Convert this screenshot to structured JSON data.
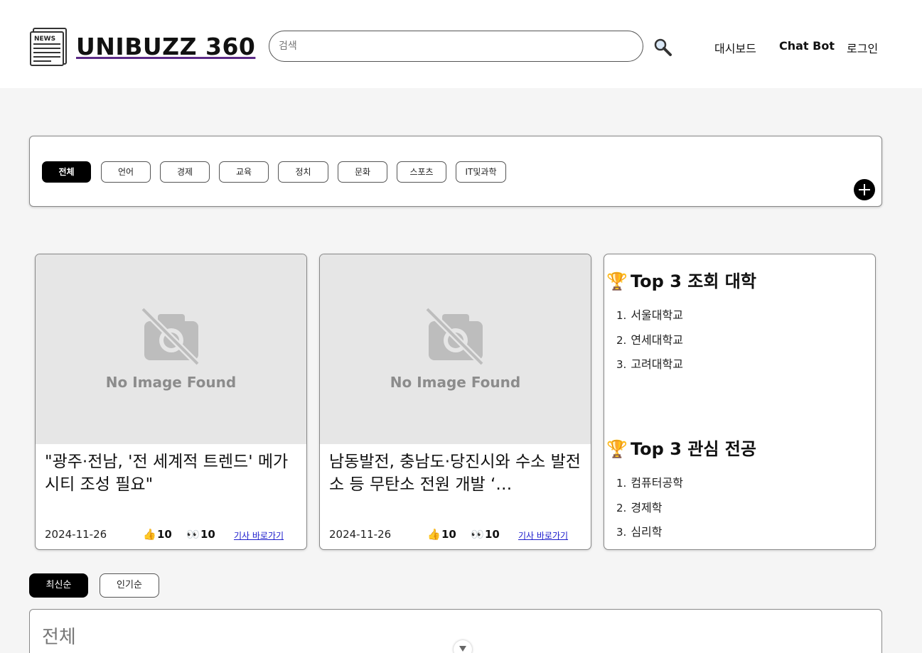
{
  "header": {
    "logo_badge": "NEWS",
    "logo_text": "UNIBUZZ 360",
    "search_placeholder": "검색",
    "search_icon": "magnifier-icon",
    "nav": {
      "dashboard": "대시보드",
      "chatbot": "Chat Bot",
      "login": "로그인"
    }
  },
  "categories": [
    {
      "label": "전체",
      "active": true
    },
    {
      "label": "언어"
    },
    {
      "label": "경제"
    },
    {
      "label": "교육"
    },
    {
      "label": "정치"
    },
    {
      "label": "문화"
    },
    {
      "label": "스포츠"
    },
    {
      "label": "IT및과학"
    }
  ],
  "add_category_icon": "plus-icon",
  "articles": [
    {
      "image_text": "No Image Found",
      "title": "\"광주·전남, '전 세계적 트렌드' 메가시티 조성 필요\"",
      "date": "2024-11-26",
      "likes": "10",
      "views": "10",
      "link_label": "기사 바로가기"
    },
    {
      "image_text": "No Image Found",
      "title": "남동발전, 충남도·당진시와 수소 발전소 등 무탄소 전원 개발 ‘…",
      "date": "2024-11-26",
      "likes": "10",
      "views": "10",
      "link_label": "기사 바로가기"
    }
  ],
  "rankings": {
    "universities": {
      "title": "Top 3 조회 대학",
      "items": [
        {
          "num": "1.",
          "name": "서울대학교"
        },
        {
          "num": "2.",
          "name": "연세대학교"
        },
        {
          "num": "3.",
          "name": "고려대학교"
        }
      ]
    },
    "majors": {
      "title": "Top 3 관심 전공",
      "items": [
        {
          "num": "1.",
          "name": "컴퓨터공학"
        },
        {
          "num": "2.",
          "name": "경제학"
        },
        {
          "num": "3.",
          "name": "심리학"
        }
      ]
    }
  },
  "sort": {
    "latest": "최신순",
    "popular": "인기순"
  },
  "list": {
    "title": "전체"
  }
}
